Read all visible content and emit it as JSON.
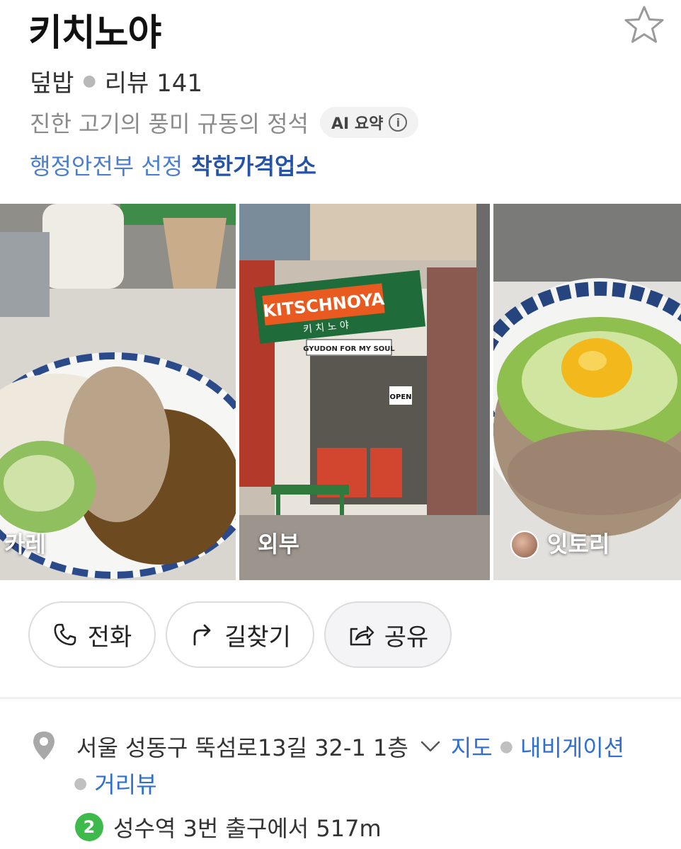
{
  "place": {
    "name": "키치노야",
    "category": "덮밥",
    "review_label": "리뷰 141",
    "summary": "진한 고기의 풍미 규동의 정석",
    "ai_badge": "AI 요약",
    "gov_prefix": "행정안전부 선정",
    "gov_badge": "착한가격업소"
  },
  "photos": [
    {
      "label": "카레"
    },
    {
      "label": "외부",
      "sign_text": "KITSCHNOYA",
      "sign_sub": "키 치 노 야",
      "banner": "GYUDON FOR MY SOUL",
      "open_sign": "OPEN"
    },
    {
      "label": "잇토리"
    }
  ],
  "actions": {
    "call": "전화",
    "directions": "길찾기",
    "share": "공유"
  },
  "address": {
    "text": "서울 성동구 뚝섬로13길 32-1 1층",
    "map": "지도",
    "navigation": "내비게이션",
    "street_view": "거리뷰"
  },
  "subway": {
    "line": "2",
    "line_color": "#3eb94b",
    "text": "성수역 3번 출구에서 517m"
  },
  "colors": {
    "link_blue": "#2e6fd0",
    "gov_blue": "#2553a8"
  }
}
